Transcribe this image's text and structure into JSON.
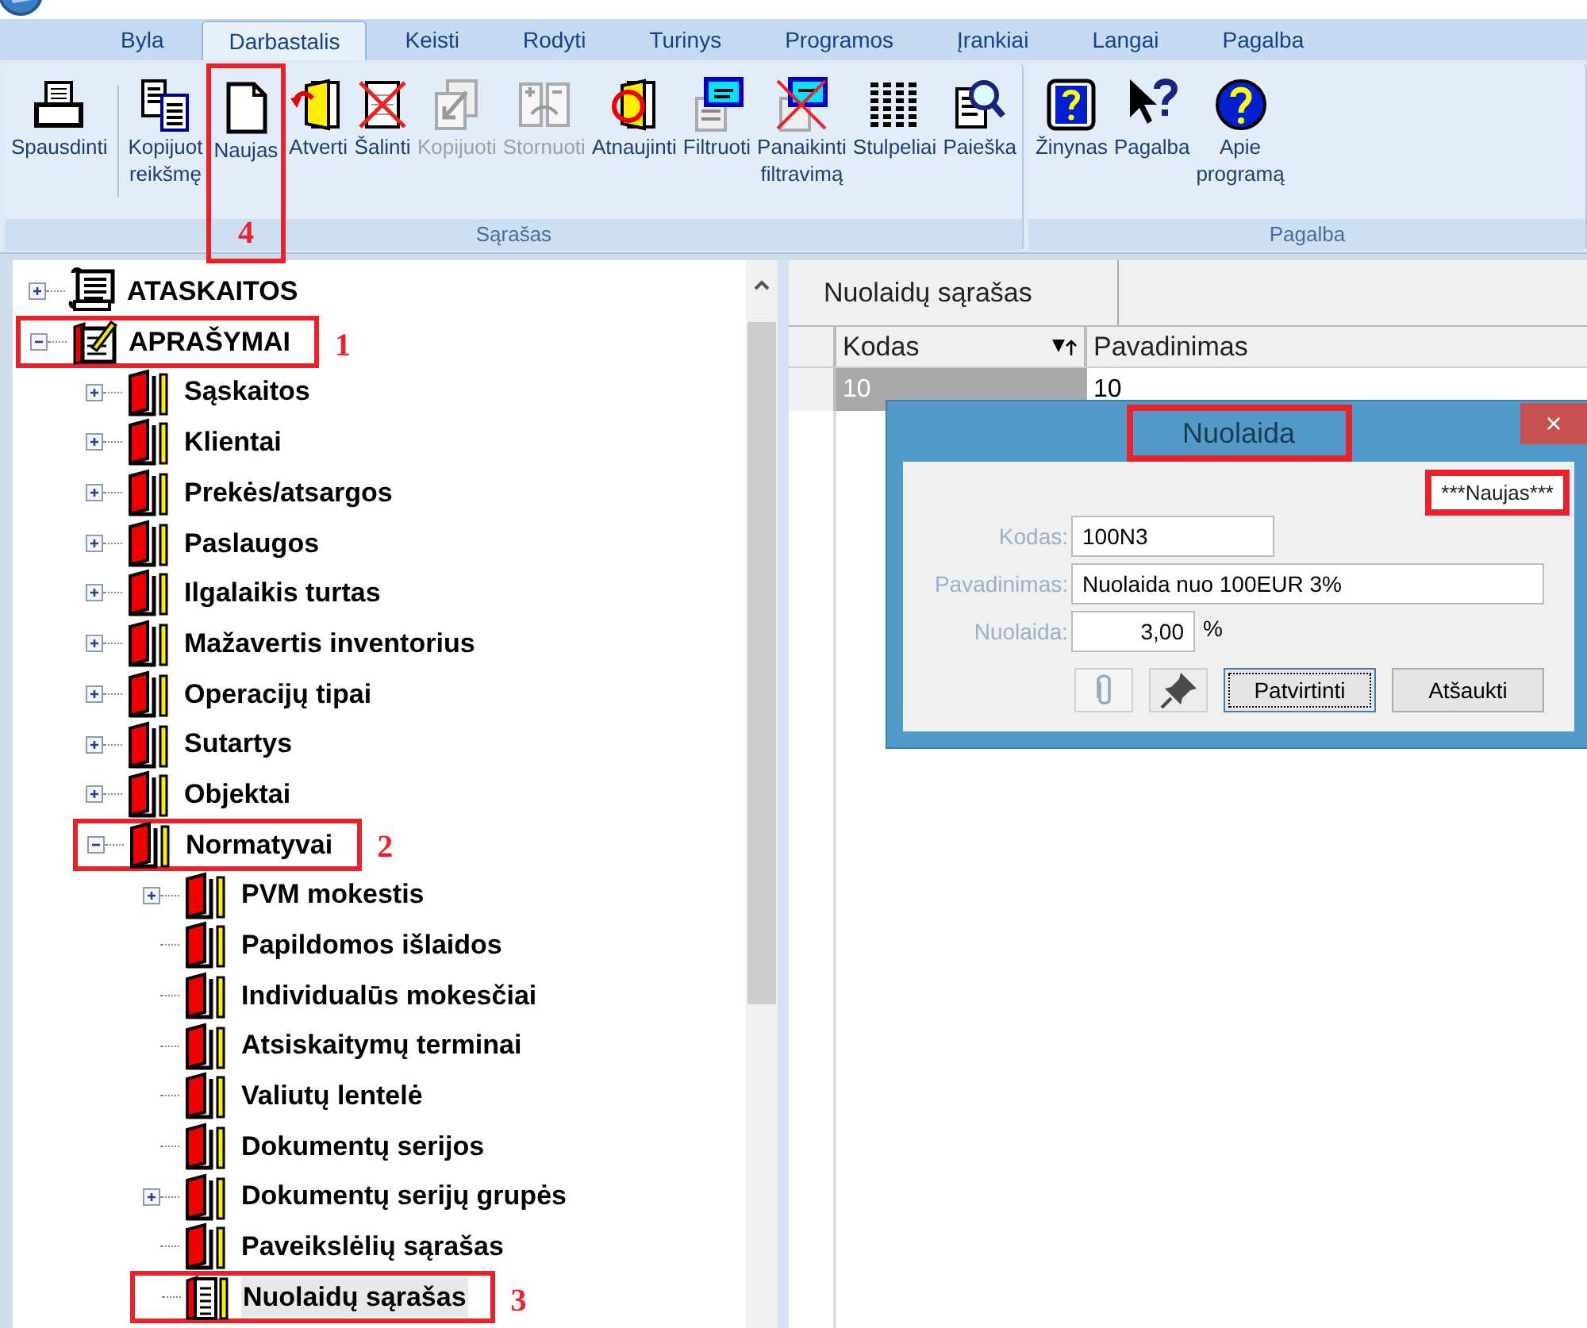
{
  "ribbon": {
    "tabs": [
      {
        "label": "Byla",
        "selected": false
      },
      {
        "label": "Darbastalis",
        "selected": true
      },
      {
        "label": "Keisti",
        "selected": false
      },
      {
        "label": "Rodyti",
        "selected": false
      },
      {
        "label": "Turinys",
        "selected": false
      },
      {
        "label": "Programos",
        "selected": false
      },
      {
        "label": "Įrankiai",
        "selected": false
      },
      {
        "label": "Langai",
        "selected": false
      },
      {
        "label": "Pagalba",
        "selected": false
      }
    ],
    "groups": [
      {
        "label": "Sąrašas",
        "buttons": [
          {
            "lines": [
              "Spausdinti"
            ],
            "kind": "printer",
            "disabled": false,
            "separator_after": true
          },
          {
            "lines": [
              "Kopijuot",
              "reikšmę"
            ],
            "kind": "copy-values",
            "disabled": false
          },
          {
            "lines": [
              "Naujas"
            ],
            "kind": "new",
            "disabled": false,
            "callout": "4"
          },
          {
            "lines": [
              "Atverti"
            ],
            "kind": "open",
            "disabled": false
          },
          {
            "lines": [
              "Šalinti"
            ],
            "kind": "delete",
            "disabled": false
          },
          {
            "lines": [
              "Kopijuoti"
            ],
            "kind": "copy",
            "disabled": true
          },
          {
            "lines": [
              "Stornuoti"
            ],
            "kind": "storno",
            "disabled": true
          },
          {
            "lines": [
              "Atnaujinti"
            ],
            "kind": "refresh",
            "disabled": false
          },
          {
            "lines": [
              "Filtruoti"
            ],
            "kind": "filter",
            "disabled": false
          },
          {
            "lines": [
              "Panaikinti",
              "filtravimą"
            ],
            "kind": "clear-filter",
            "disabled": false
          },
          {
            "lines": [
              "Stulpeliai"
            ],
            "kind": "columns",
            "disabled": false
          },
          {
            "lines": [
              "Paieška"
            ],
            "kind": "search",
            "disabled": false
          }
        ]
      },
      {
        "label": "Pagalba",
        "buttons": [
          {
            "lines": [
              "Žinynas"
            ],
            "kind": "help-book",
            "disabled": false
          },
          {
            "lines": [
              "Pagalba"
            ],
            "kind": "help-pointer",
            "disabled": false
          },
          {
            "lines": [
              "Apie",
              "programą"
            ],
            "kind": "about",
            "disabled": false
          }
        ]
      }
    ]
  },
  "tree": {
    "items": [
      {
        "label": "ATASKAITOS",
        "kind": "scroll",
        "expanded": false,
        "selected": false
      },
      {
        "label": "APRAŠYMAI",
        "kind": "notepad",
        "expanded": true,
        "selected": false,
        "callout": "1",
        "children": [
          {
            "label": "Sąskaitos",
            "kind": "book",
            "expanded": false,
            "selected": false
          },
          {
            "label": "Klientai",
            "kind": "book",
            "expanded": false,
            "selected": false
          },
          {
            "label": "Prekės/atsargos",
            "kind": "book",
            "expanded": false,
            "selected": false
          },
          {
            "label": "Paslaugos",
            "kind": "book",
            "expanded": false,
            "selected": false
          },
          {
            "label": "Ilgalaikis turtas",
            "kind": "book",
            "expanded": false,
            "selected": false
          },
          {
            "label": "Mažavertis inventorius",
            "kind": "book",
            "expanded": false,
            "selected": false
          },
          {
            "label": "Operacijų tipai",
            "kind": "book",
            "expanded": false,
            "selected": false
          },
          {
            "label": "Sutartys",
            "kind": "book",
            "expanded": false,
            "selected": false
          },
          {
            "label": "Objektai",
            "kind": "book",
            "expanded": false,
            "selected": false
          },
          {
            "label": "Normatyvai",
            "kind": "book",
            "expanded": true,
            "selected": false,
            "callout": "2",
            "children": [
              {
                "label": "PVM mokestis",
                "kind": "book",
                "expanded": false,
                "selected": false
              },
              {
                "label": "Papildomos išlaidos",
                "kind": "book",
                "selected": false
              },
              {
                "label": "Individualūs mokesčiai",
                "kind": "book",
                "selected": false
              },
              {
                "label": "Atsiskaitymų terminai",
                "kind": "book",
                "selected": false
              },
              {
                "label": "Valiutų lentelė",
                "kind": "book",
                "selected": false
              },
              {
                "label": "Dokumentų serijos",
                "kind": "book",
                "selected": false
              },
              {
                "label": "Dokumentų serijų grupės",
                "kind": "book",
                "expanded": false,
                "selected": false
              },
              {
                "label": "Paveikslėlių sąrašas",
                "kind": "book",
                "selected": false
              },
              {
                "label": "Nuolaidų sąrašas",
                "kind": "list-book",
                "selected": true,
                "callout": "3"
              }
            ]
          }
        ]
      }
    ]
  },
  "document": {
    "tab": "Nuolaidų sąrašas",
    "columns": [
      {
        "label": "Kodas",
        "sort_icon": true
      },
      {
        "label": "Pavadinimas",
        "sort_icon": false
      }
    ],
    "rows": [
      {
        "cells": [
          "10",
          "10"
        ],
        "selected": true
      }
    ]
  },
  "dialog": {
    "title": "Nuolaida",
    "title_callout": true,
    "close": "×",
    "status": "***Naujas***",
    "status_callout": true,
    "fields": [
      {
        "label": "Kodas:",
        "value": "100N3"
      },
      {
        "label": "Pavadinimas:",
        "value": "Nuolaida nuo 100EUR 3%"
      },
      {
        "label": "Nuolaida:",
        "value": "3,00",
        "suffix": "%"
      }
    ],
    "icon_buttons": [
      {
        "kind": "paperclip",
        "disabled": true
      },
      {
        "kind": "pin",
        "disabled": false
      }
    ],
    "buttons": [
      {
        "label": "Patvirtinti",
        "focused": true
      },
      {
        "label": "Atšaukti",
        "focused": false
      }
    ]
  }
}
